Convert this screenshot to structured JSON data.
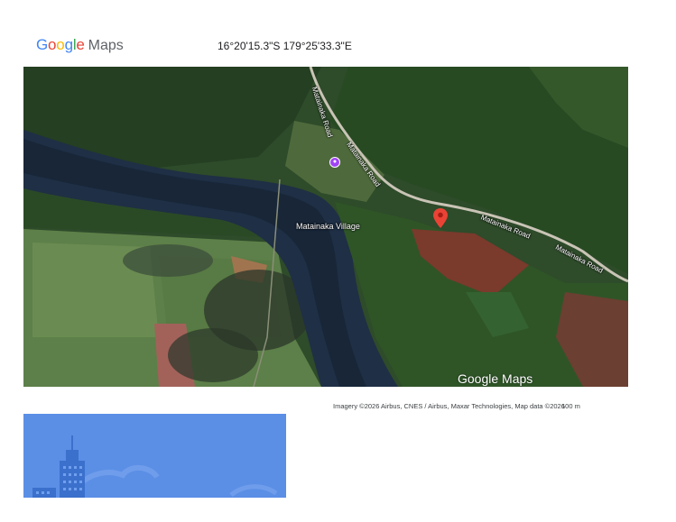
{
  "header": {
    "logo": {
      "letters": [
        {
          "ch": "G",
          "color": "#4285F4"
        },
        {
          "ch": "o",
          "color": "#EA4335"
        },
        {
          "ch": "o",
          "color": "#FBBC05"
        },
        {
          "ch": "g",
          "color": "#4285F4"
        },
        {
          "ch": "l",
          "color": "#34A853"
        },
        {
          "ch": "e",
          "color": "#EA4335"
        }
      ],
      "maps_word": "Maps"
    },
    "coordinates": "16°20'15.3\"S 179°25'33.3\"E"
  },
  "map": {
    "place_label": "Matainaka Village",
    "place_icon": "place-marker-icon",
    "road_labels": [
      "Matainaka Road",
      "Matainaka Road",
      "Matainaka Road",
      "Matainaka Road"
    ],
    "pin": {
      "icon": "location-pin-icon",
      "color": "#EA4335"
    },
    "watermark": "Google Maps"
  },
  "footer": {
    "attribution": "Imagery ©2026 Airbus, CNES / Airbus, Maxar Technologies, Map data ©2026",
    "scale": "100 m"
  },
  "street_view": {
    "background": "#5b8fe6",
    "icon": "city-buildings-icon"
  }
}
